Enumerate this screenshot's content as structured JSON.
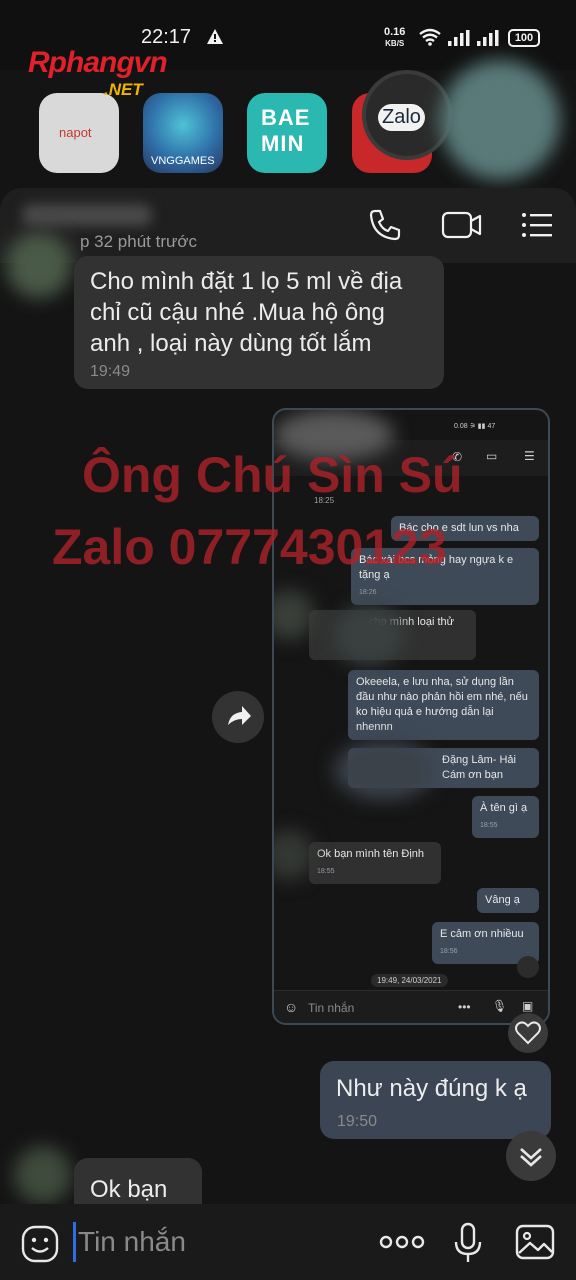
{
  "status_bar": {
    "time": "22:17",
    "net_speed_value": "0.16",
    "net_speed_unit": "KB/S",
    "battery": "100"
  },
  "watermark": {
    "logo_main": "Rphangvn",
    "logo_sub": ".NET",
    "line1": "Ông Chú Sìn Sú",
    "line2": "Zalo 0777430123"
  },
  "background_apps": {
    "app1_label": "napot",
    "app2_label": "VNGGAMES",
    "app3_label": "BAE MIN",
    "zalo_label": "Zalo"
  },
  "chat_header": {
    "subtitle": "p 32 phút trước"
  },
  "messages": {
    "incoming_1": {
      "text": "Cho mình đặt 1 lọ 5 ml về địa chỉ cũ cậu nhé .Mua hộ ông anh , loại này dùng tốt lắm",
      "time": "19:49"
    },
    "outgoing_1": {
      "text": "Như này đúng k ạ",
      "time": "19:50"
    },
    "incoming_2": {
      "text": "Ok bạn"
    }
  },
  "embedded_screenshot": {
    "status": "0.08",
    "battery": "47",
    "top_time": "18:25",
    "bubbles": [
      {
        "dir": "out",
        "text": "Bác cho e sdt lun vs nha",
        "time": ""
      },
      {
        "dir": "out",
        "text": "Bác xài bcs mỏng hay ngựa k e tặng ạ",
        "time": "18:26"
      },
      {
        "dir": "in",
        "text": "cho mình loại thử",
        "time": ""
      },
      {
        "dir": "out",
        "text": "Okeeela, e lưu nha, sử dụng lần đầu như nào phản hồi em nhé, nếu ko hiệu quả e hướng dẫn lại nhennn",
        "time": ""
      },
      {
        "dir": "out",
        "text": "Đặng Lâm- Hải Cám ơn bạn",
        "time": ""
      },
      {
        "dir": "out",
        "text": "À tên gì ạ",
        "time": "18:55"
      },
      {
        "dir": "in",
        "text": "Ok bạn mình tên Định",
        "time": "18:55"
      },
      {
        "dir": "out",
        "text": "Vâng ạ",
        "time": ""
      },
      {
        "dir": "out",
        "text": "E cảm ơn nhiềuu",
        "time": "18:56"
      }
    ],
    "date_pill": "19:49, 24/03/2021",
    "input_placeholder": "Tin nhắn"
  },
  "input_bar": {
    "placeholder": "Tin nhắn"
  },
  "colors": {
    "background": "#141414",
    "bubble_in": "#323232",
    "bubble_out": "#3b4554",
    "watermark": "#aa2228",
    "caret": "#2d6fe0"
  },
  "icons": [
    "warning-icon",
    "wifi-icon",
    "signal-icon",
    "battery-icon",
    "phone-icon",
    "video-call-icon",
    "menu-icon",
    "share-icon",
    "heart-icon",
    "scroll-down-icon",
    "sticker-icon",
    "more-icon",
    "mic-icon",
    "image-icon"
  ]
}
